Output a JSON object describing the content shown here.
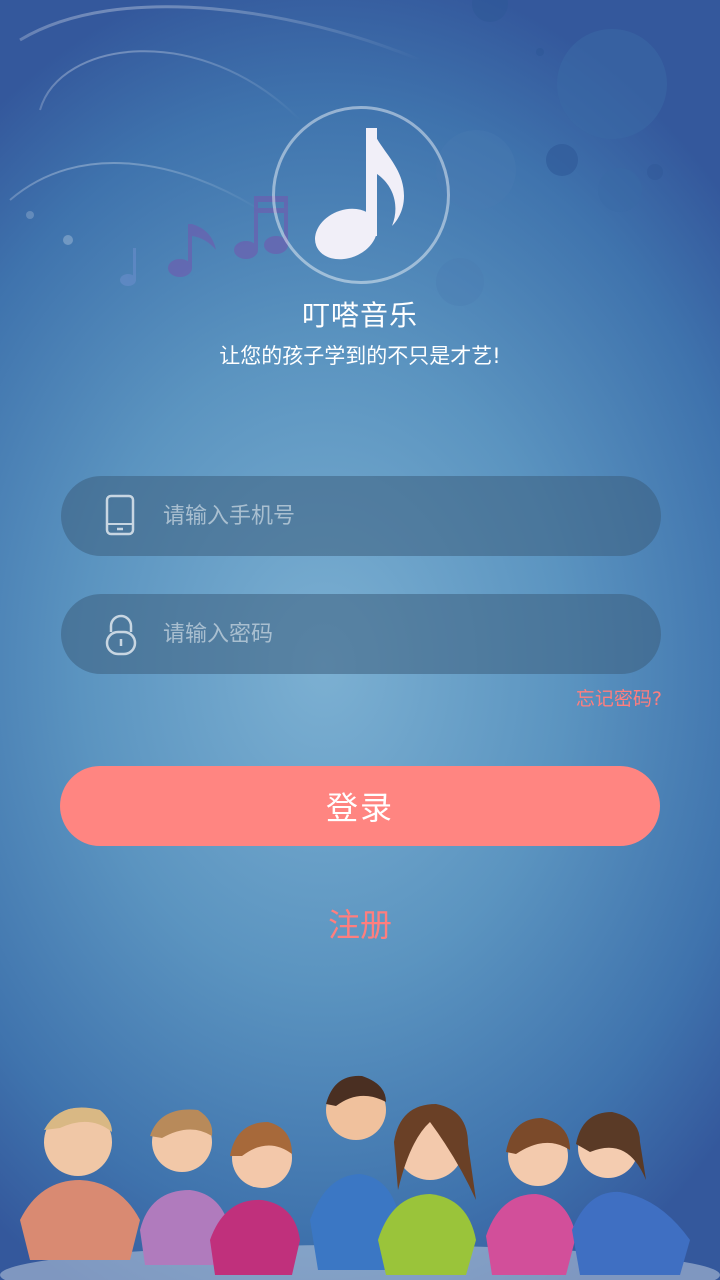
{
  "app": {
    "title": "叮嗒音乐",
    "slogan": "让您的孩子学到的不只是才艺!"
  },
  "form": {
    "phone_placeholder": "请输入手机号",
    "password_placeholder": "请输入密码",
    "forgot_label": "忘记密码?",
    "login_label": "登录",
    "register_label": "注册"
  },
  "icons": {
    "logo": "music-note-icon",
    "phone": "phone-icon",
    "password": "lock-icon"
  },
  "colors": {
    "accent": "#ff8581",
    "link": "#ff7e7e",
    "background": "#5b94c0"
  }
}
